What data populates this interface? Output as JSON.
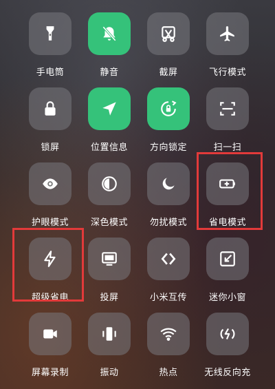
{
  "tiles": [
    {
      "label": "手电筒",
      "icon": "flashlight-icon",
      "active": false
    },
    {
      "label": "静音",
      "icon": "bell-off-icon",
      "active": true
    },
    {
      "label": "截屏",
      "icon": "screenshot-icon",
      "active": false
    },
    {
      "label": "飞行模式",
      "icon": "airplane-icon",
      "active": false
    },
    {
      "label": "锁屏",
      "icon": "lock-icon",
      "active": false
    },
    {
      "label": "位置信息",
      "icon": "location-arrow-icon",
      "active": true
    },
    {
      "label": "方向锁定",
      "icon": "rotation-lock-icon",
      "active": true
    },
    {
      "label": "扫一扫",
      "icon": "scan-icon",
      "active": false
    },
    {
      "label": "护眼模式",
      "icon": "eye-icon",
      "active": false
    },
    {
      "label": "深色模式",
      "icon": "dark-mode-icon",
      "active": false
    },
    {
      "label": "勿扰模式",
      "icon": "moon-icon",
      "active": false
    },
    {
      "label": "省电模式",
      "icon": "battery-saver-icon",
      "active": false
    },
    {
      "label": "超级省电",
      "icon": "lightning-icon",
      "active": false
    },
    {
      "label": "投屏",
      "icon": "cast-screen-icon",
      "active": false
    },
    {
      "label": "小米互传",
      "icon": "share-transfer-icon",
      "active": false
    },
    {
      "label": "迷你小窗",
      "icon": "mini-window-icon",
      "active": false
    },
    {
      "label": "屏幕录制",
      "icon": "video-record-icon",
      "active": false
    },
    {
      "label": "振动",
      "icon": "vibrate-icon",
      "active": false
    },
    {
      "label": "热点",
      "icon": "hotspot-icon",
      "active": false
    },
    {
      "label": "无线反向充",
      "icon": "reverse-charge-icon",
      "active": false
    }
  ],
  "colors": {
    "active": "#35c27a",
    "highlight": "#e23a3a"
  }
}
